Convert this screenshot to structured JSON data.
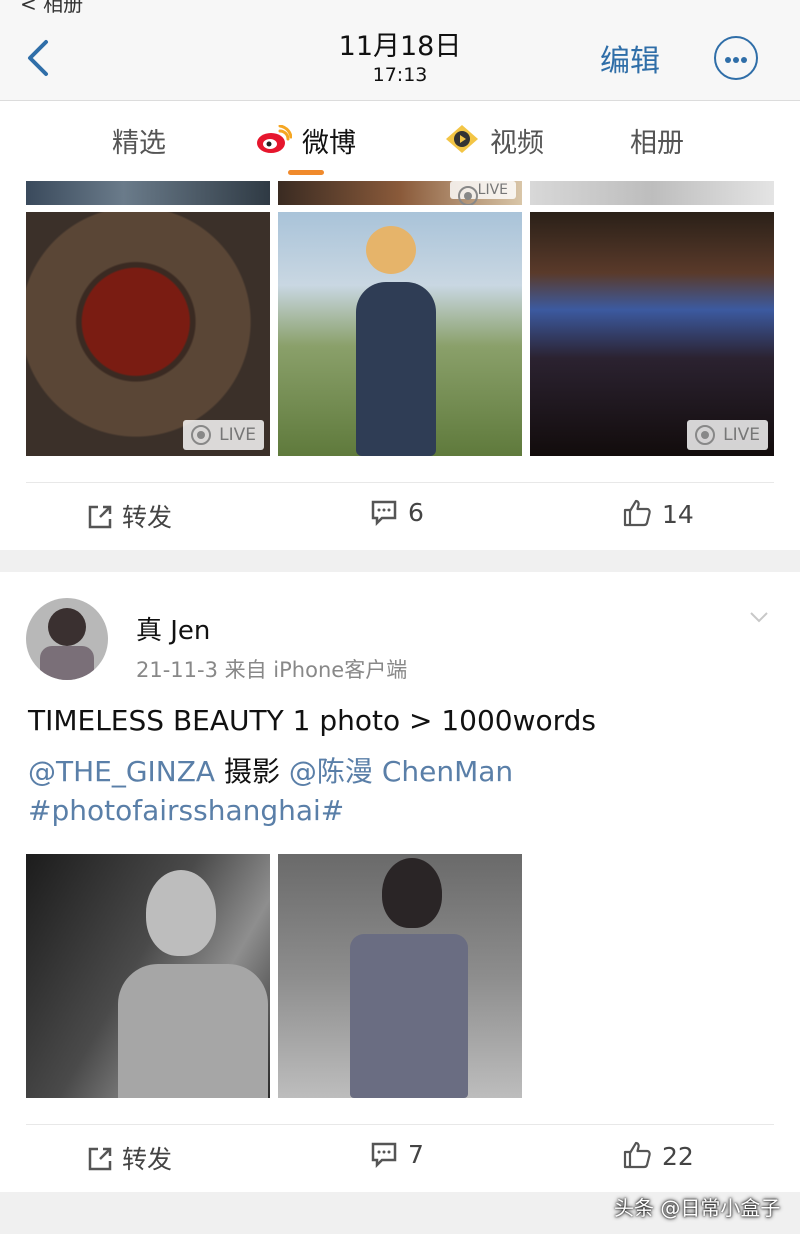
{
  "header": {
    "top_cropped_label": "< 相册",
    "date": "11月18日",
    "time": "17:13",
    "edit_label": "编辑"
  },
  "tabs": [
    {
      "label": "精选"
    },
    {
      "label": "微博"
    },
    {
      "label": "视频"
    },
    {
      "label": "相册"
    }
  ],
  "live_badge": "LIVE",
  "post1": {
    "repost_label": "转发",
    "comments": "6",
    "likes": "14"
  },
  "post2": {
    "username": "真 Jen",
    "meta": "21-11-3  来自 iPhone客户端",
    "text_line1": "TIMELESS BEAUTY  1 photo > 1000words",
    "mention1": "@THE_GINZA",
    "text_mid": "摄影",
    "mention2": "@陈漫 ChenMan",
    "hashtag": "#photofairsshanghai#",
    "repost_label": "转发",
    "comments": "7",
    "likes": "22"
  },
  "watermark": "头条 @日常小盒子",
  "colors": {
    "accent": "#2f6ea8",
    "link": "#5a7fa8",
    "tab_underline": "#f08a2c",
    "weibo_red": "#e6162d"
  }
}
